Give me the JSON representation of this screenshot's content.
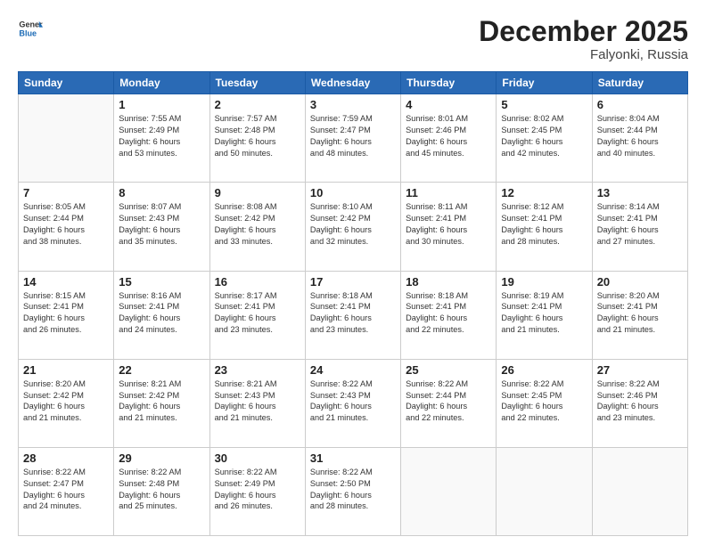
{
  "header": {
    "logo_line1": "General",
    "logo_line2": "Blue",
    "month": "December 2025",
    "location": "Falyonki, Russia"
  },
  "days_of_week": [
    "Sunday",
    "Monday",
    "Tuesday",
    "Wednesday",
    "Thursday",
    "Friday",
    "Saturday"
  ],
  "weeks": [
    [
      {
        "day": "",
        "info": ""
      },
      {
        "day": "1",
        "info": "Sunrise: 7:55 AM\nSunset: 2:49 PM\nDaylight: 6 hours\nand 53 minutes."
      },
      {
        "day": "2",
        "info": "Sunrise: 7:57 AM\nSunset: 2:48 PM\nDaylight: 6 hours\nand 50 minutes."
      },
      {
        "day": "3",
        "info": "Sunrise: 7:59 AM\nSunset: 2:47 PM\nDaylight: 6 hours\nand 48 minutes."
      },
      {
        "day": "4",
        "info": "Sunrise: 8:01 AM\nSunset: 2:46 PM\nDaylight: 6 hours\nand 45 minutes."
      },
      {
        "day": "5",
        "info": "Sunrise: 8:02 AM\nSunset: 2:45 PM\nDaylight: 6 hours\nand 42 minutes."
      },
      {
        "day": "6",
        "info": "Sunrise: 8:04 AM\nSunset: 2:44 PM\nDaylight: 6 hours\nand 40 minutes."
      }
    ],
    [
      {
        "day": "7",
        "info": "Sunrise: 8:05 AM\nSunset: 2:44 PM\nDaylight: 6 hours\nand 38 minutes."
      },
      {
        "day": "8",
        "info": "Sunrise: 8:07 AM\nSunset: 2:43 PM\nDaylight: 6 hours\nand 35 minutes."
      },
      {
        "day": "9",
        "info": "Sunrise: 8:08 AM\nSunset: 2:42 PM\nDaylight: 6 hours\nand 33 minutes."
      },
      {
        "day": "10",
        "info": "Sunrise: 8:10 AM\nSunset: 2:42 PM\nDaylight: 6 hours\nand 32 minutes."
      },
      {
        "day": "11",
        "info": "Sunrise: 8:11 AM\nSunset: 2:41 PM\nDaylight: 6 hours\nand 30 minutes."
      },
      {
        "day": "12",
        "info": "Sunrise: 8:12 AM\nSunset: 2:41 PM\nDaylight: 6 hours\nand 28 minutes."
      },
      {
        "day": "13",
        "info": "Sunrise: 8:14 AM\nSunset: 2:41 PM\nDaylight: 6 hours\nand 27 minutes."
      }
    ],
    [
      {
        "day": "14",
        "info": "Sunrise: 8:15 AM\nSunset: 2:41 PM\nDaylight: 6 hours\nand 26 minutes."
      },
      {
        "day": "15",
        "info": "Sunrise: 8:16 AM\nSunset: 2:41 PM\nDaylight: 6 hours\nand 24 minutes."
      },
      {
        "day": "16",
        "info": "Sunrise: 8:17 AM\nSunset: 2:41 PM\nDaylight: 6 hours\nand 23 minutes."
      },
      {
        "day": "17",
        "info": "Sunrise: 8:18 AM\nSunset: 2:41 PM\nDaylight: 6 hours\nand 23 minutes."
      },
      {
        "day": "18",
        "info": "Sunrise: 8:18 AM\nSunset: 2:41 PM\nDaylight: 6 hours\nand 22 minutes."
      },
      {
        "day": "19",
        "info": "Sunrise: 8:19 AM\nSunset: 2:41 PM\nDaylight: 6 hours\nand 21 minutes."
      },
      {
        "day": "20",
        "info": "Sunrise: 8:20 AM\nSunset: 2:41 PM\nDaylight: 6 hours\nand 21 minutes."
      }
    ],
    [
      {
        "day": "21",
        "info": "Sunrise: 8:20 AM\nSunset: 2:42 PM\nDaylight: 6 hours\nand 21 minutes."
      },
      {
        "day": "22",
        "info": "Sunrise: 8:21 AM\nSunset: 2:42 PM\nDaylight: 6 hours\nand 21 minutes."
      },
      {
        "day": "23",
        "info": "Sunrise: 8:21 AM\nSunset: 2:43 PM\nDaylight: 6 hours\nand 21 minutes."
      },
      {
        "day": "24",
        "info": "Sunrise: 8:22 AM\nSunset: 2:43 PM\nDaylight: 6 hours\nand 21 minutes."
      },
      {
        "day": "25",
        "info": "Sunrise: 8:22 AM\nSunset: 2:44 PM\nDaylight: 6 hours\nand 22 minutes."
      },
      {
        "day": "26",
        "info": "Sunrise: 8:22 AM\nSunset: 2:45 PM\nDaylight: 6 hours\nand 22 minutes."
      },
      {
        "day": "27",
        "info": "Sunrise: 8:22 AM\nSunset: 2:46 PM\nDaylight: 6 hours\nand 23 minutes."
      }
    ],
    [
      {
        "day": "28",
        "info": "Sunrise: 8:22 AM\nSunset: 2:47 PM\nDaylight: 6 hours\nand 24 minutes."
      },
      {
        "day": "29",
        "info": "Sunrise: 8:22 AM\nSunset: 2:48 PM\nDaylight: 6 hours\nand 25 minutes."
      },
      {
        "day": "30",
        "info": "Sunrise: 8:22 AM\nSunset: 2:49 PM\nDaylight: 6 hours\nand 26 minutes."
      },
      {
        "day": "31",
        "info": "Sunrise: 8:22 AM\nSunset: 2:50 PM\nDaylight: 6 hours\nand 28 minutes."
      },
      {
        "day": "",
        "info": ""
      },
      {
        "day": "",
        "info": ""
      },
      {
        "day": "",
        "info": ""
      }
    ]
  ]
}
